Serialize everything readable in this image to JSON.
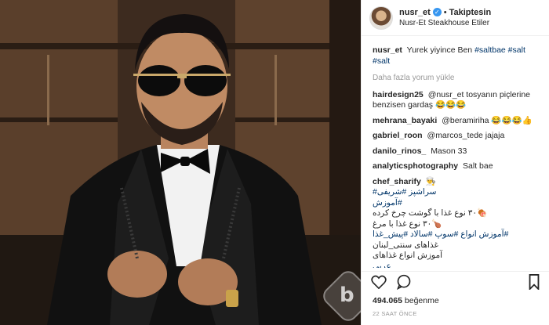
{
  "post": {
    "username": "nusr_et",
    "follow_label": "Takiptesin",
    "separator": "•",
    "location": "Nusr-Et Steakhouse Etiler",
    "caption_user": "nusr_et",
    "caption_text": "Yurek yiyince Ben",
    "caption_tags": "#saltbae #salt #salt",
    "load_more": "Daha fazla yorum yükle",
    "likes_count": "494.065",
    "likes_label": "beğenme",
    "timestamp": "22 SAAT ÖNCE"
  },
  "comments": [
    {
      "user": "hairdesign25",
      "text": "@nusr_et tosyanın piçlerine benzisen gardaş 😂😂😂"
    },
    {
      "user": "mehrana_bayaki",
      "text": "@beramiriha 😂😂😂👍"
    },
    {
      "user": "gabriel_roon",
      "text": "@marcos_tede jajaja"
    },
    {
      "user": "danilo_rinos_",
      "text": "Mason 33"
    },
    {
      "user": "analyticsphotography",
      "text": "Salt bae"
    },
    {
      "user": "chef_sharify",
      "text": "👨‍🍳"
    }
  ],
  "chef_lines": [
    "سراشپز #شریفی#",
    "#آموزش",
    "🍖۳۰ نوع غذا با گوشت چرخ کرده",
    "🍗۳۰ نوع غذا با مرغ",
    "#آموزش انواع #سوپ #سالاد #پیش_غذا",
    "غذاهای سنتی_لبنان",
    "آموزش انواع غذاهای",
    "عربی"
  ],
  "icons": {
    "heart": "heart-icon",
    "comment": "comment-icon",
    "bookmark": "bookmark-icon",
    "verified": "verified-badge-icon"
  },
  "colors": {
    "link": "#003569",
    "verified": "#3897f0",
    "muted": "#999999"
  }
}
